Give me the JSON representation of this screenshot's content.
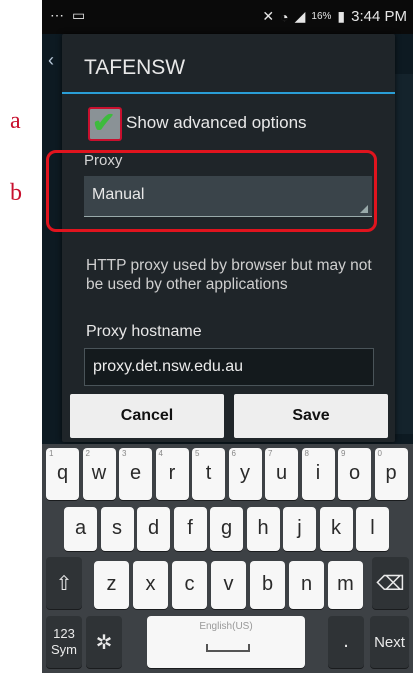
{
  "annotations": {
    "a": "a",
    "b": "b"
  },
  "status_bar": {
    "time": "3:44 PM",
    "battery_pct": "16%",
    "icons": [
      "dots-icon",
      "image-icon",
      "mute-icon",
      "wifi-icon",
      "signal-icon",
      "battery-icon"
    ]
  },
  "dialog": {
    "title": "TAFENSW",
    "show_advanced": {
      "label": "Show advanced options",
      "checked": true
    },
    "proxy": {
      "label": "Proxy",
      "value": "Manual"
    },
    "help_text": "HTTP proxy used by browser but may not be used by other applications",
    "hostname": {
      "label": "Proxy hostname",
      "value": "proxy.det.nsw.edu.au"
    },
    "buttons": {
      "cancel": "Cancel",
      "save": "Save"
    }
  },
  "keyboard": {
    "row1": [
      {
        "k": "q",
        "h": "1"
      },
      {
        "k": "w",
        "h": "2"
      },
      {
        "k": "e",
        "h": "3"
      },
      {
        "k": "r",
        "h": "4"
      },
      {
        "k": "t",
        "h": "5"
      },
      {
        "k": "y",
        "h": "6"
      },
      {
        "k": "u",
        "h": "7"
      },
      {
        "k": "i",
        "h": "8"
      },
      {
        "k": "o",
        "h": "9"
      },
      {
        "k": "p",
        "h": "0"
      }
    ],
    "row2": [
      "a",
      "s",
      "d",
      "f",
      "g",
      "h",
      "j",
      "k",
      "l"
    ],
    "row3": [
      "z",
      "x",
      "c",
      "v",
      "b",
      "n",
      "m"
    ],
    "sym_label_1": "123",
    "sym_label_2": "Sym",
    "space_label": "English(US)",
    "period": ".",
    "next_label": "Next"
  },
  "colors": {
    "accent_blue": "#2a9ed6",
    "highlight_red": "#e0141e",
    "check_green": "#3dbb3d"
  }
}
